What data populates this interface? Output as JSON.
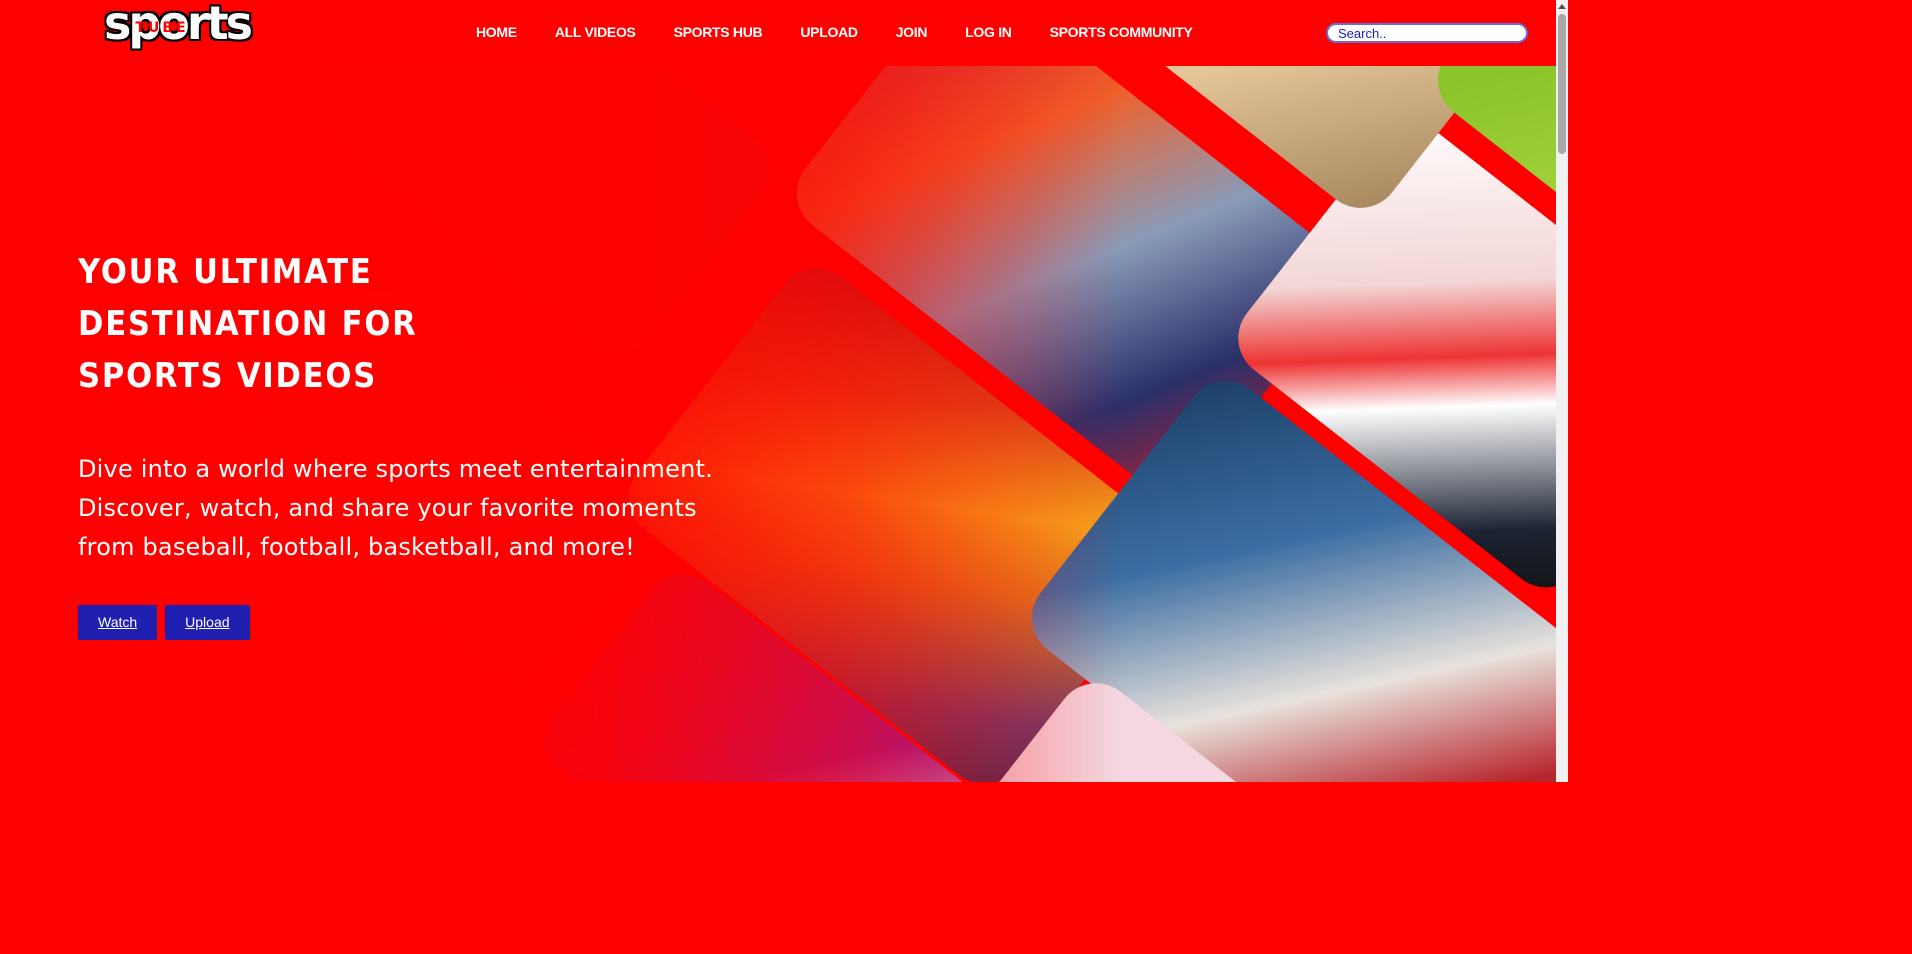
{
  "logo": {
    "word": "sports",
    "tube": "TUBE"
  },
  "nav": {
    "items": [
      "HOME",
      "ALL VIDEOS",
      "SPORTS HUB",
      "UPLOAD",
      "JOIN",
      "LOG IN",
      "SPORTS COMMUNITY"
    ]
  },
  "search": {
    "placeholder": "Search.."
  },
  "hero": {
    "title_line1": "YOUR ULTIMATE DESTINATION FOR",
    "title_line2": "SPORTS VIDEOS",
    "description_line1": "Dive into a world where sports meet entertainment.",
    "description_line2": "Discover, watch, and share your favorite moments",
    "description_line3": "from baseball, football, basketball, and more!",
    "watch_label": "Watch",
    "upload_label": "Upload"
  },
  "colors": {
    "brand": "#ff0000",
    "button": "#2020b0"
  }
}
